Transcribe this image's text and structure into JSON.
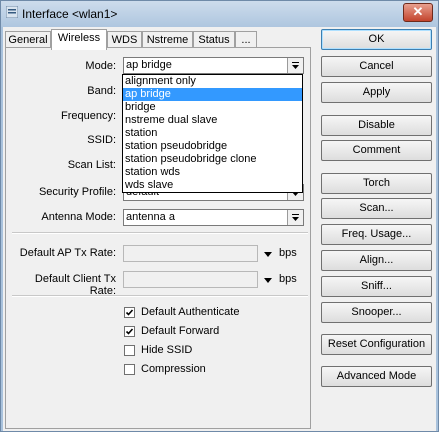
{
  "window": {
    "title": "Interface <wlan1>",
    "close_label": "✕"
  },
  "tabs": [
    {
      "label": "General"
    },
    {
      "label": "Wireless"
    },
    {
      "label": "WDS"
    },
    {
      "label": "Nstreme"
    },
    {
      "label": "Status"
    },
    {
      "label": "..."
    }
  ],
  "form": {
    "mode_label": "Mode:",
    "mode_value": "ap bridge",
    "band_label": "Band:",
    "frequency_label": "Frequency:",
    "ssid_label": "SSID:",
    "scan_list_label": "Scan List:",
    "security_profile_label": "Security Profile:",
    "security_profile_value": "default",
    "antenna_mode_label": "Antenna Mode:",
    "antenna_mode_value": "antenna a",
    "default_ap_tx_rate_label": "Default AP Tx Rate:",
    "default_client_tx_rate_label": "Default Client Tx Rate:",
    "bps_unit": "bps",
    "checkboxes": [
      {
        "label": "Default Authenticate",
        "checked": true
      },
      {
        "label": "Default Forward",
        "checked": true
      },
      {
        "label": "Hide SSID",
        "checked": false
      },
      {
        "label": "Compression",
        "checked": false
      }
    ]
  },
  "mode_dropdown": {
    "options": [
      "alignment only",
      "ap bridge",
      "bridge",
      "nstreme dual slave",
      "station",
      "station pseudobridge",
      "station pseudobridge clone",
      "station wds",
      "wds slave"
    ],
    "selected": "ap bridge"
  },
  "buttons": {
    "ok": "OK",
    "cancel": "Cancel",
    "apply": "Apply",
    "disable": "Disable",
    "comment": "Comment",
    "torch": "Torch",
    "scan": "Scan...",
    "freq_usage": "Freq. Usage...",
    "align": "Align...",
    "sniff": "Sniff...",
    "snooper": "Snooper...",
    "reset_configuration": "Reset Configuration",
    "advanced_mode": "Advanced Mode"
  },
  "colors": {
    "selection": "#3399ff",
    "title_bar": "#aec6df",
    "close_button": "#c3442d"
  }
}
